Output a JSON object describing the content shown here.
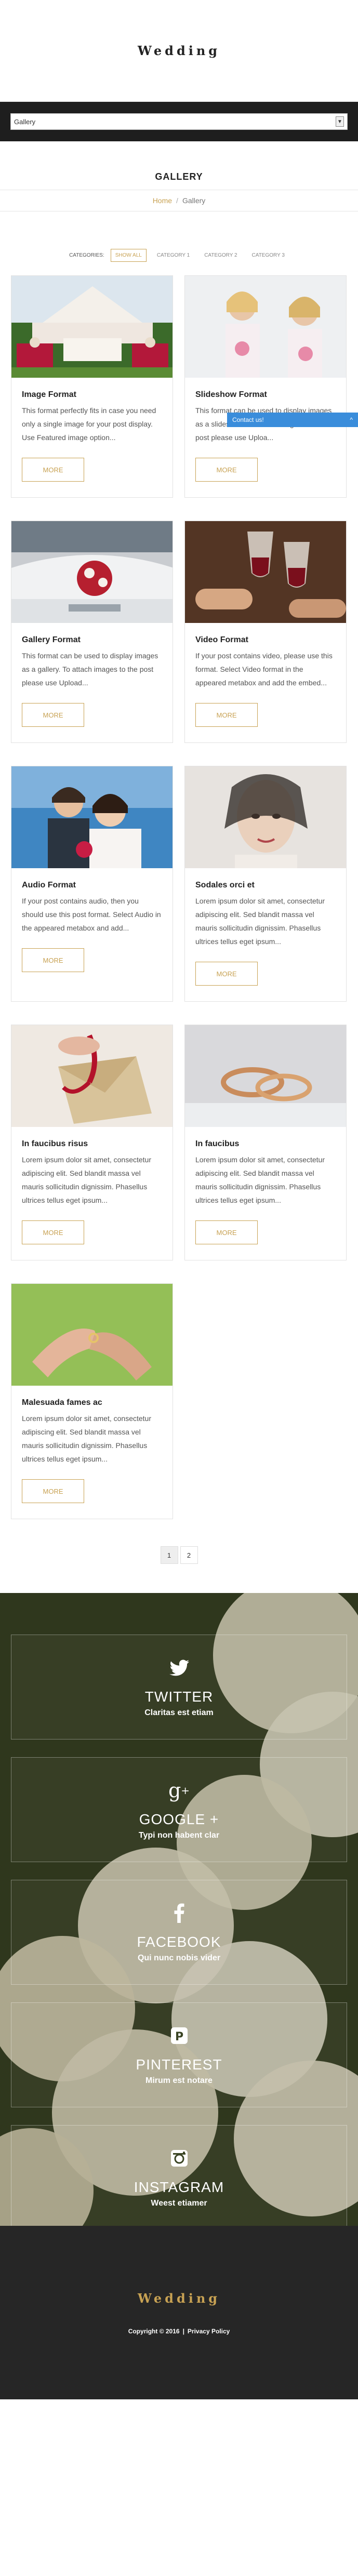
{
  "header": {
    "logo": "Wedding"
  },
  "nav": {
    "select_value": "Gallery"
  },
  "page": {
    "title": "GALLERY"
  },
  "breadcrumb": {
    "home": "Home",
    "separator": "/",
    "current": "Gallery"
  },
  "filters": {
    "label": "CATEGORIES:",
    "items": [
      "SHOW ALL",
      "CATEGORY 1",
      "CATEGORY 2",
      "CATEGORY 3"
    ],
    "active": "SHOW ALL"
  },
  "contact_tab": {
    "label": "Contact us!",
    "chevron": "^"
  },
  "posts": [
    {
      "title": "Image Format",
      "excerpt": "This format perfectly fits in case you need only a single image for your post display. Use Featured image option...",
      "more": "MORE",
      "image": "wedding-reception-tables"
    },
    {
      "title": "Slideshow Format",
      "excerpt": "This format can be used to display images as a slideshow. To attach images to the post please use Uploa...",
      "more": "MORE",
      "image": "bridesmaids"
    },
    {
      "title": "Gallery Format",
      "excerpt": "This format can be used to display images as a gallery. To attach images to the post please use Upload...",
      "more": "MORE",
      "image": "wedding-car-flowers"
    },
    {
      "title": "Video Format",
      "excerpt": "If your post contains video, please use this format. Select Video format in the appeared metabox and add the embed...",
      "more": "MORE",
      "image": "wine-glasses"
    },
    {
      "title": "Audio Format",
      "excerpt": "If your post contains audio, then you should use this post format. Select Audio in the appeared metabox and add...",
      "more": "MORE",
      "image": "bride-groom"
    },
    {
      "title": "Sodales orci et",
      "excerpt": "Lorem ipsum dolor sit amet, consectetur adipiscing elit. Sed blandit massa vel mauris sollicitudin dignissim. Phasellus ultrices tellus eget ipsum...",
      "more": "MORE",
      "image": "bride-veil"
    },
    {
      "title": "In faucibus risus",
      "excerpt": "Lorem ipsum dolor sit amet, consectetur adipiscing elit. Sed blandit massa vel mauris sollicitudin dignissim. Phasellus ultrices tellus eget ipsum...",
      "more": "MORE",
      "image": "envelope-ribbon"
    },
    {
      "title": "In faucibus",
      "excerpt": "Lorem ipsum dolor sit amet, consectetur adipiscing elit. Sed blandit massa vel mauris sollicitudin dignissim. Phasellus ultrices tellus eget ipsum...",
      "more": "MORE",
      "image": "wedding-rings"
    },
    {
      "title": "Malesuada fames ac",
      "excerpt": "Lorem ipsum dolor sit amet, consectetur adipiscing elit. Sed blandit massa vel mauris sollicitudin dignissim. Phasellus ultrices tellus eget ipsum...",
      "more": "MORE",
      "image": "hands-ring"
    }
  ],
  "pagination": {
    "pages": [
      "1",
      "2"
    ],
    "active": "1"
  },
  "social": [
    {
      "name": "TWITTER",
      "sub": "Claritas est etiam",
      "icon": "twitter-icon"
    },
    {
      "name": "GOOGLE +",
      "sub": "Typi non habent clar",
      "icon": "google-plus-icon"
    },
    {
      "name": "FACEBOOK",
      "sub": "Qui nunc nobis vider",
      "icon": "facebook-icon"
    },
    {
      "name": "PINTEREST",
      "sub": "Mirum est notare",
      "icon": "pinterest-icon"
    },
    {
      "name": "INSTAGRAM",
      "sub": "Weest etiamer",
      "icon": "instagram-icon"
    }
  ],
  "footer": {
    "logo": "Wedding",
    "copyright": "Copyright © 2016",
    "divider": "|",
    "privacy": "Privacy Policy"
  },
  "colors": {
    "accent": "#c8a253",
    "nav_bg": "#1e1e1e",
    "footer_bg": "#262626",
    "contact": "#3a8ddb"
  }
}
